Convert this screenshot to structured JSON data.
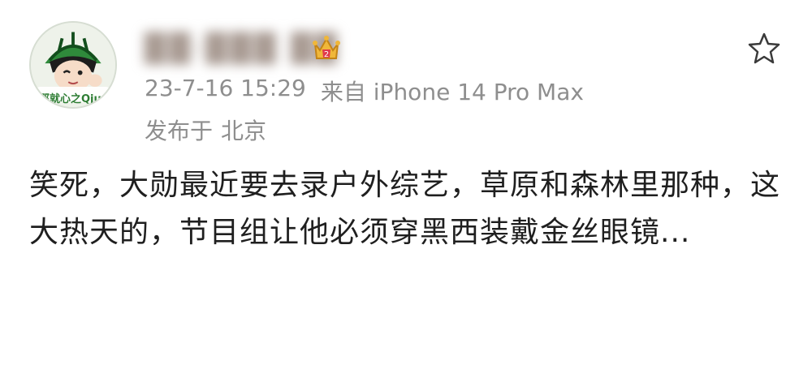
{
  "post": {
    "username": "██·███ ██",
    "timestamp": "23-7-16 15:29",
    "source": "来自 iPhone 14 Pro Max",
    "location_prefix": "发布于",
    "location": "北京",
    "text": "笑死，大勋最近要去录户外综艺，草原和森林里那种，这大热天的，节目组让他必须穿黑西装戴金丝眼镜...",
    "avatar_caption": "那就心之Qjup",
    "badge_level": "2"
  },
  "icons": {
    "favorite": "star-outline-icon",
    "badge": "crown-icon"
  },
  "colors": {
    "meta_text": "#8e8e8e",
    "body_text": "#1f1f1f",
    "crown_gold": "#e3a72f",
    "crown_red": "#e0394a"
  }
}
